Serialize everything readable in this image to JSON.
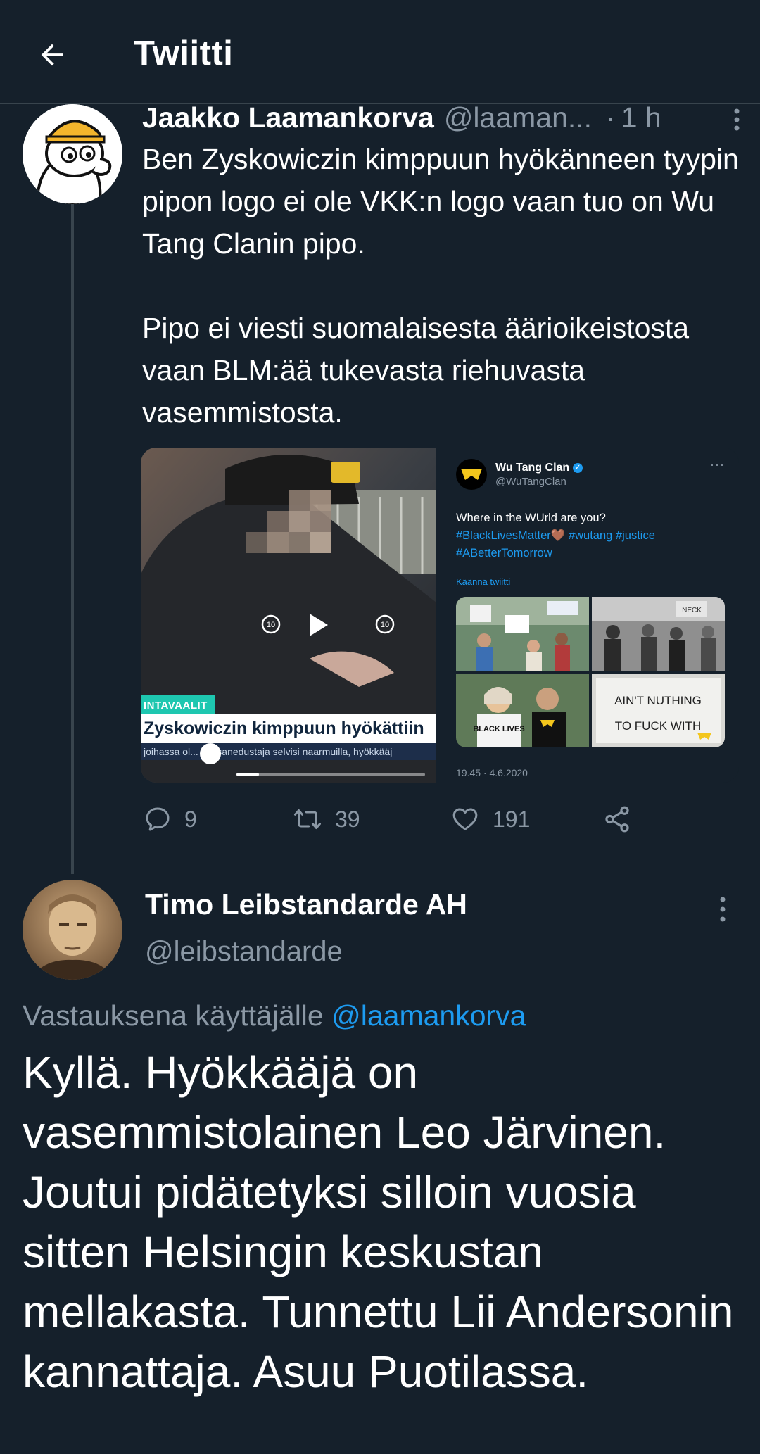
{
  "header": {
    "title": "Twiitti",
    "back_icon": "arrow-left-icon"
  },
  "tweet1": {
    "name": "Jaakko Laamankorva",
    "handle": "@laaman...",
    "dot": "·",
    "time": "1 h",
    "text": "Ben Zyskowiczin kimppuun hyökänneen tyypin pipon logo ei ole VKK:n logo vaan tuo on Wu Tang Clanin pipo.\n\nPipo ei viesti suomalaisesta äärioikeistosta vaan BLM:ää tukevasta riehuvasta vasemmistosta.",
    "video": {
      "banner_top": "INTAVAALIT",
      "banner_main": "Zyskowiczin kimppuun hyökättiin",
      "banner_sub": "joihassa ol... kansanedustaja selvisi naarmuilla, hyökkääj",
      "progress": 0.12
    },
    "embed": {
      "name": "Wu Tang Clan",
      "handle": "@WuTangClan",
      "more": "···",
      "text_plain": "Where in the WUrld are you?",
      "hashtag_1": "#BlackLivesMatter",
      "hashtag_2": "#wutang",
      "hashtag_3": "#justice",
      "hashtag_4": "#ABetterTomorrow",
      "translate": "Käännä twiitti",
      "date": "19.45 · 4.6.2020",
      "sign_text_1": "AIN'T NUTHING",
      "sign_text_2": "TO FUCK WITH",
      "sign_text_3": "NECK",
      "sign_text_4": "BLACK LIVES"
    },
    "actions": {
      "reply_count": "9",
      "retweet_count": "39",
      "like_count": "191"
    }
  },
  "tweet2": {
    "name": "Timo Leibstandarde AH",
    "handle": "@leibstandarde",
    "reply_prefix": "Vastauksena käyttäjälle",
    "reply_mention": "@laamankorva",
    "text": "Kyllä. Hyökkääjä on vasemmistolainen Leo Järvinen. Joutui pidätetyksi silloin vuosia sitten Helsingin keskustan mellakasta. Tunnettu Lii Andersonin kannattaja. Asuu Puotilassa."
  },
  "colors": {
    "background": "#15202b",
    "text_secondary": "#8b98a5",
    "accent": "#1d9bf0",
    "divider": "#38444d"
  }
}
